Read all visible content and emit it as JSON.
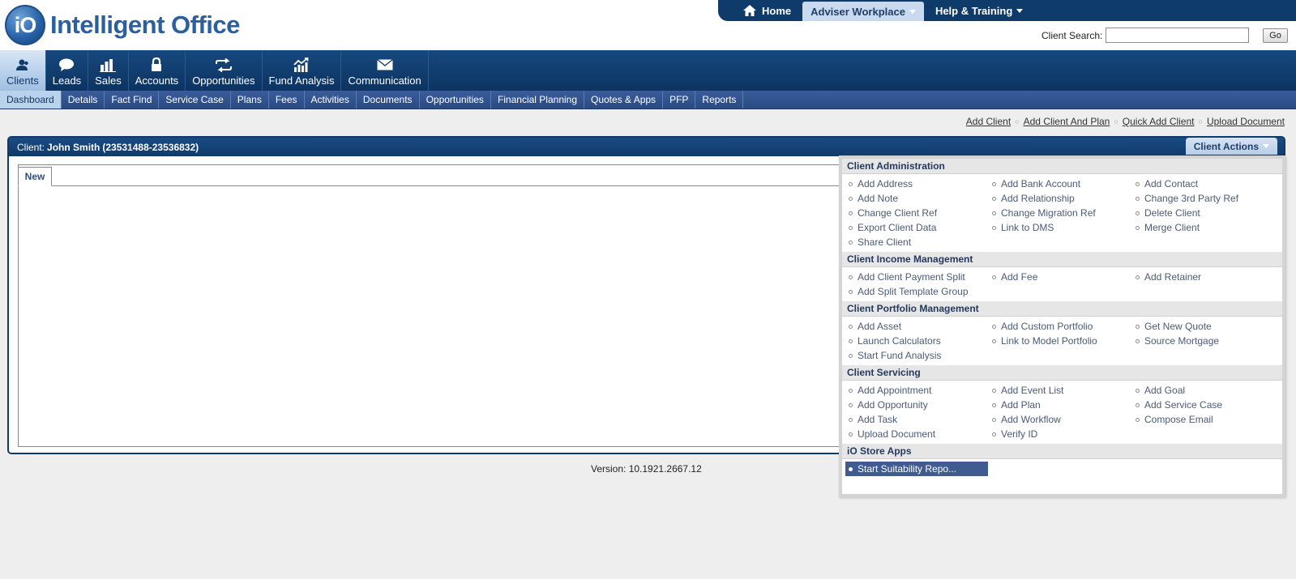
{
  "logo": {
    "mark": "iO",
    "text": "Intelligent Office"
  },
  "topbar": {
    "home": "Home",
    "adviser_workplace": "Adviser Workplace",
    "help_training": "Help & Training"
  },
  "search": {
    "label": "Client Search:",
    "value": "",
    "go": "Go"
  },
  "mainnav": [
    {
      "label": "Clients",
      "icon": "user-icon"
    },
    {
      "label": "Leads",
      "icon": "speech-bubble-icon"
    },
    {
      "label": "Sales",
      "icon": "bar-chart-icon"
    },
    {
      "label": "Accounts",
      "icon": "lock-icon"
    },
    {
      "label": "Opportunities",
      "icon": "swap-arrows-icon"
    },
    {
      "label": "Fund Analysis",
      "icon": "growth-chart-icon"
    },
    {
      "label": "Communication",
      "icon": "envelope-icon"
    }
  ],
  "subnav": [
    "Dashboard",
    "Details",
    "Fact Find",
    "Service Case",
    "Plans",
    "Fees",
    "Activities",
    "Documents",
    "Opportunities",
    "Financial Planning",
    "Quotes & Apps",
    "PFP",
    "Reports"
  ],
  "quick_links": [
    "Add Client",
    "Add Client And Plan",
    "Quick Add Client",
    "Upload Document"
  ],
  "client_panel": {
    "label": "Client:",
    "name": "John Smith",
    "ids": "(23531488-23536832)",
    "actions_label": "Client Actions",
    "tab": "New"
  },
  "version": "Version: 10.1921.2667.12",
  "client_actions": [
    {
      "title": "Client Administration",
      "items": [
        "Add Address",
        "Add Bank Account",
        "Add Contact",
        "Add Note",
        "Add Relationship",
        "Change 3rd Party Ref",
        "Change Client Ref",
        "Change Migration Ref",
        "Delete Client",
        "Export Client Data",
        "Link to DMS",
        "Merge Client",
        "Share Client"
      ]
    },
    {
      "title": "Client Income Management",
      "items": [
        "Add Client Payment Split",
        "Add Fee",
        "Add Retainer",
        "Add Split Template Group"
      ]
    },
    {
      "title": "Client Portfolio Management",
      "items": [
        "Add Asset",
        "Add Custom Portfolio",
        "Get New Quote",
        "Launch Calculators",
        "Link to Model Portfolio",
        "Source Mortgage",
        "Start Fund Analysis"
      ]
    },
    {
      "title": "Client Servicing",
      "items": [
        "Add Appointment",
        "Add Event List",
        "Add Goal",
        "Add Opportunity",
        "Add Plan",
        "Add Service Case",
        "Add Task",
        "Add Workflow",
        "Compose Email",
        "Upload Document",
        "Verify ID"
      ]
    },
    {
      "title": "iO Store Apps",
      "items": [
        "Start Suitability Repo..."
      ],
      "highlighted": "Start Suitability Repo..."
    }
  ],
  "colors": {
    "navy": "#0f3b6b",
    "subnav": "#294a84",
    "highlight": "#3f5b8f",
    "logo_blue": "#2b5f9e"
  }
}
